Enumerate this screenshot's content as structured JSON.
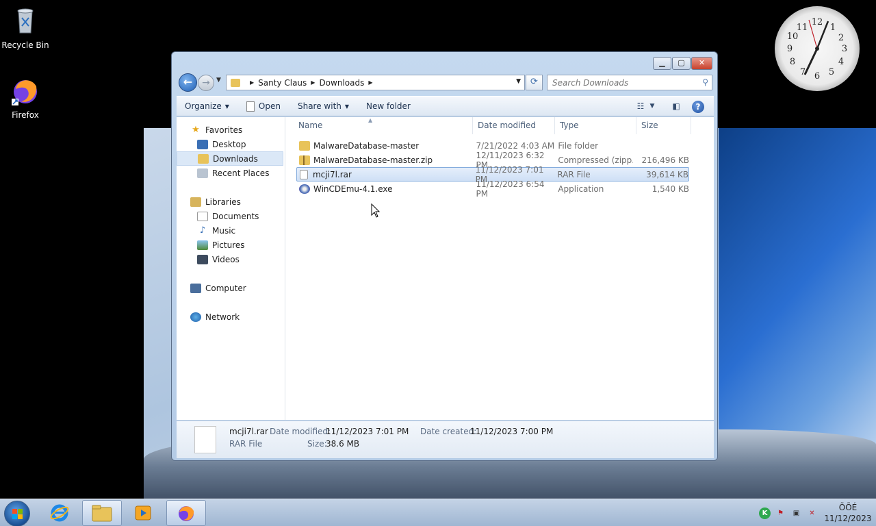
{
  "desktop": {
    "icons": [
      {
        "label": "Recycle Bin",
        "icon": "recycle-bin-icon"
      },
      {
        "label": "Firefox",
        "icon": "firefox-icon"
      }
    ]
  },
  "window": {
    "controls": {
      "minimize": "minimize",
      "maximize": "maximize",
      "close": "close"
    },
    "breadcrumb": [
      "Santy Claus",
      "Downloads"
    ],
    "search_placeholder": "Search Downloads",
    "toolbar": {
      "organize": "Organize",
      "open": "Open",
      "share_with": "Share with",
      "new_folder": "New folder"
    },
    "nav": {
      "favorites": "Favorites",
      "desktop": "Desktop",
      "downloads": "Downloads",
      "recent_places": "Recent Places",
      "libraries": "Libraries",
      "documents": "Documents",
      "music": "Music",
      "pictures": "Pictures",
      "videos": "Videos",
      "computer": "Computer",
      "network": "Network"
    },
    "columns": {
      "name": "Name",
      "date_modified": "Date modified",
      "type": "Type",
      "size": "Size"
    },
    "files": [
      {
        "name": "MalwareDatabase-master",
        "date": "7/21/2022 4:03 AM",
        "type": "File folder",
        "size": "",
        "icon": "folder-icon",
        "selected": false
      },
      {
        "name": "MalwareDatabase-master.zip",
        "date": "12/11/2023 6:32 PM",
        "type": "Compressed (zipp...",
        "size": "216,496 KB",
        "icon": "zip-folder-icon",
        "selected": false
      },
      {
        "name": "mcji7l.rar",
        "date": "11/12/2023 7:01 PM",
        "type": "RAR File",
        "size": "39,614 KB",
        "icon": "blank-file-icon",
        "selected": true
      },
      {
        "name": "WinCDEmu-4.1.exe",
        "date": "11/12/2023 6:54 PM",
        "type": "Application",
        "size": "1,540 KB",
        "icon": "installer-icon",
        "selected": false
      }
    ],
    "details": {
      "filename": "mcji7l.rar",
      "filetype": "RAR File",
      "date_modified_label": "Date modified:",
      "date_modified": "11/12/2023 7:01 PM",
      "size_label": "Size:",
      "size": "38.6 MB",
      "date_created_label": "Date created:",
      "date_created": "11/12/2023 7:00 PM"
    }
  },
  "clock": {
    "numerals": [
      "12",
      "1",
      "2",
      "3",
      "4",
      "5",
      "6",
      "7",
      "8",
      "9",
      "10",
      "11"
    ]
  },
  "taskbar": {
    "time": "ÕÕÉ",
    "date": "11/12/2023"
  }
}
